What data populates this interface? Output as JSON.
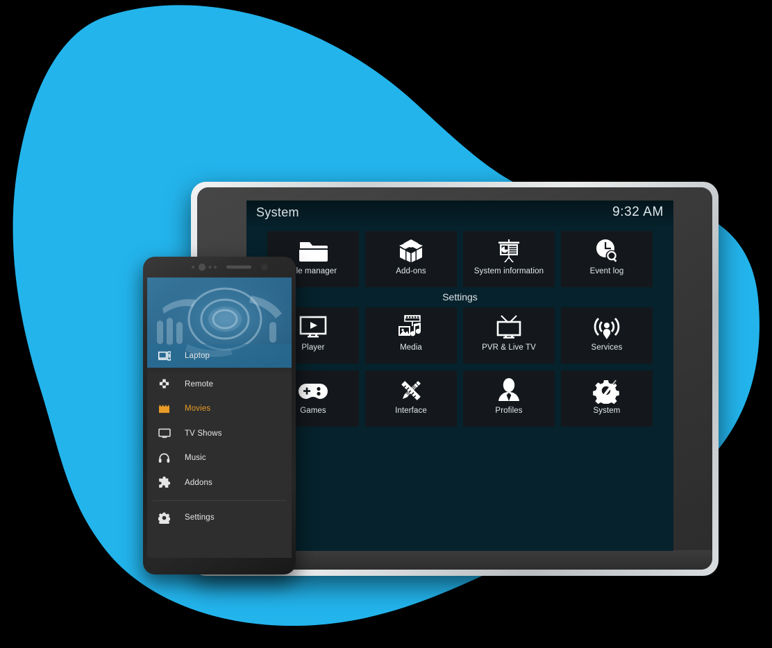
{
  "theme": {
    "blob_blue": "#23b4ec",
    "accent_orange": "#e89b26",
    "tile_bg": "#14181c",
    "screen_bg": "#06222c",
    "phone_body": "#262626"
  },
  "laptop": {
    "device_name": "laptop-mockup",
    "kodi": {
      "title": "System",
      "clock": "9:32 AM",
      "section_label": "Settings",
      "top_row": [
        {
          "label": "File manager",
          "icon": "folder-icon"
        },
        {
          "label": "Add-ons",
          "icon": "open-box-icon"
        },
        {
          "label": "System information",
          "icon": "presentation-chart-icon"
        },
        {
          "label": "Event log",
          "icon": "clock-search-icon"
        }
      ],
      "settings_rows": [
        [
          {
            "label": "Player",
            "icon": "monitor-play-icon"
          },
          {
            "label": "Media",
            "icon": "photo-music-film-icon"
          },
          {
            "label": "PVR & Live TV",
            "icon": "television-icon"
          },
          {
            "label": "Services",
            "icon": "broadcast-person-icon"
          }
        ],
        [
          {
            "label": "Games",
            "icon": "gamepad-icon"
          },
          {
            "label": "Interface",
            "icon": "pencil-ruler-icon"
          },
          {
            "label": "Profiles",
            "icon": "person-icon"
          },
          {
            "label": "System",
            "icon": "gear-wrench-icon"
          }
        ]
      ]
    }
  },
  "phone": {
    "device_name": "phone-mockup",
    "header": {
      "artwork": "audio-speaker-artwork",
      "active_item": "Laptop",
      "active_icon": "laptop-phone-icon"
    },
    "menu": [
      {
        "label": "Remote",
        "icon": "dpad-icon",
        "active": false
      },
      {
        "label": "Movies",
        "icon": "clapperboard-icon",
        "active": true
      },
      {
        "label": "TV Shows",
        "icon": "tv-monitor-icon",
        "active": false
      },
      {
        "label": "Music",
        "icon": "headphones-icon",
        "active": false
      },
      {
        "label": "Addons",
        "icon": "puzzle-piece-icon",
        "active": false
      }
    ],
    "footer_menu": [
      {
        "label": "Settings",
        "icon": "gear-icon",
        "active": false
      }
    ]
  }
}
